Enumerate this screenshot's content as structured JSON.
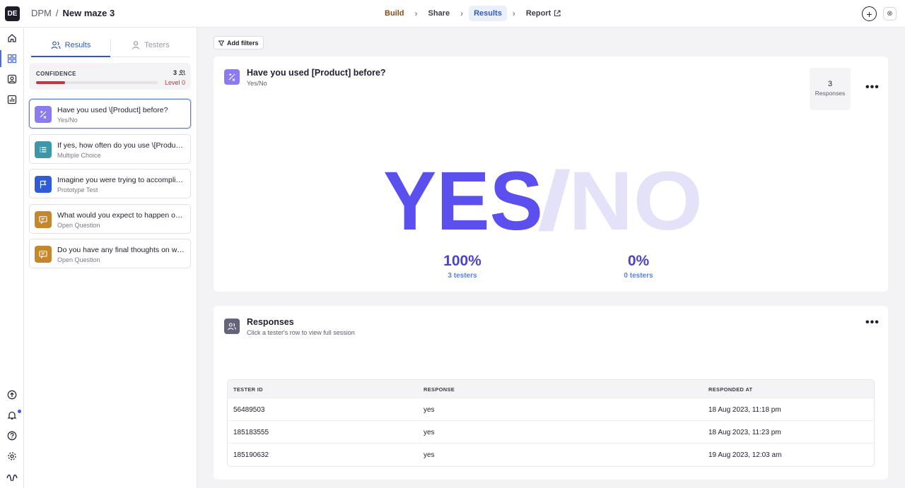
{
  "topbar": {
    "logo": "DE",
    "org": "DPM",
    "separator": "/",
    "maze_name": "New maze 3",
    "steps": [
      {
        "label": "Build"
      },
      {
        "label": "Share"
      },
      {
        "label": "Results"
      },
      {
        "label": "Report"
      }
    ]
  },
  "sidebar_tabs": {
    "results": "Results",
    "testers": "Testers"
  },
  "confidence": {
    "label": "CONFIDENCE",
    "count": "3",
    "level": "Level 0",
    "progress_fraction": 0.24
  },
  "questions": [
    {
      "title": "Have you used \\[Product] before?",
      "type": "Yes/No",
      "icon": "yes-no-icon",
      "color": "#8a7cf0",
      "selected": true
    },
    {
      "title": "If yes, how often do you use \\[Product] ?",
      "type": "Multiple Choice",
      "icon": "list-icon",
      "color": "#3e97a8",
      "selected": false
    },
    {
      "title": "Imagine you were trying to accomplish a task",
      "type": "Prototype Test",
      "icon": "flag-icon",
      "color": "#2f5bd8",
      "selected": false
    },
    {
      "title": "What would you expect to happen on this screen?",
      "type": "Open Question",
      "icon": "chat-icon",
      "color": "#c6872c",
      "selected": false
    },
    {
      "title": "Do you have any final thoughts on what you saw?",
      "type": "Open Question",
      "icon": "chat-icon",
      "color": "#c6872c",
      "selected": false
    }
  ],
  "main": {
    "filter_label": "Add filters",
    "question_card": {
      "title": "Have you used [Product] before?",
      "subtitle": "Yes/No",
      "responses_count": "3",
      "responses_label": "Responses",
      "graphic_yes": "YES",
      "graphic_slash": "/",
      "graphic_no": "NO",
      "yes_pct": "100%",
      "yes_testers": "3 testers",
      "no_pct": "0%",
      "no_testers": "0 testers",
      "colors": {
        "yes": "#5b4ff0",
        "no": "#e4e2f9"
      }
    },
    "responses_card": {
      "title": "Responses",
      "subtitle": "Click a tester's row to view full session",
      "columns": [
        "TESTER ID",
        "RESPONSE",
        "RESPONDED AT"
      ],
      "rows": [
        {
          "id": "56489503",
          "response": "yes",
          "at": "18 Aug 2023, 11:18 pm"
        },
        {
          "id": "185183555",
          "response": "yes",
          "at": "18 Aug 2023, 11:23 pm"
        },
        {
          "id": "185190632",
          "response": "yes",
          "at": "19 Aug 2023, 12:03 am"
        }
      ]
    }
  }
}
